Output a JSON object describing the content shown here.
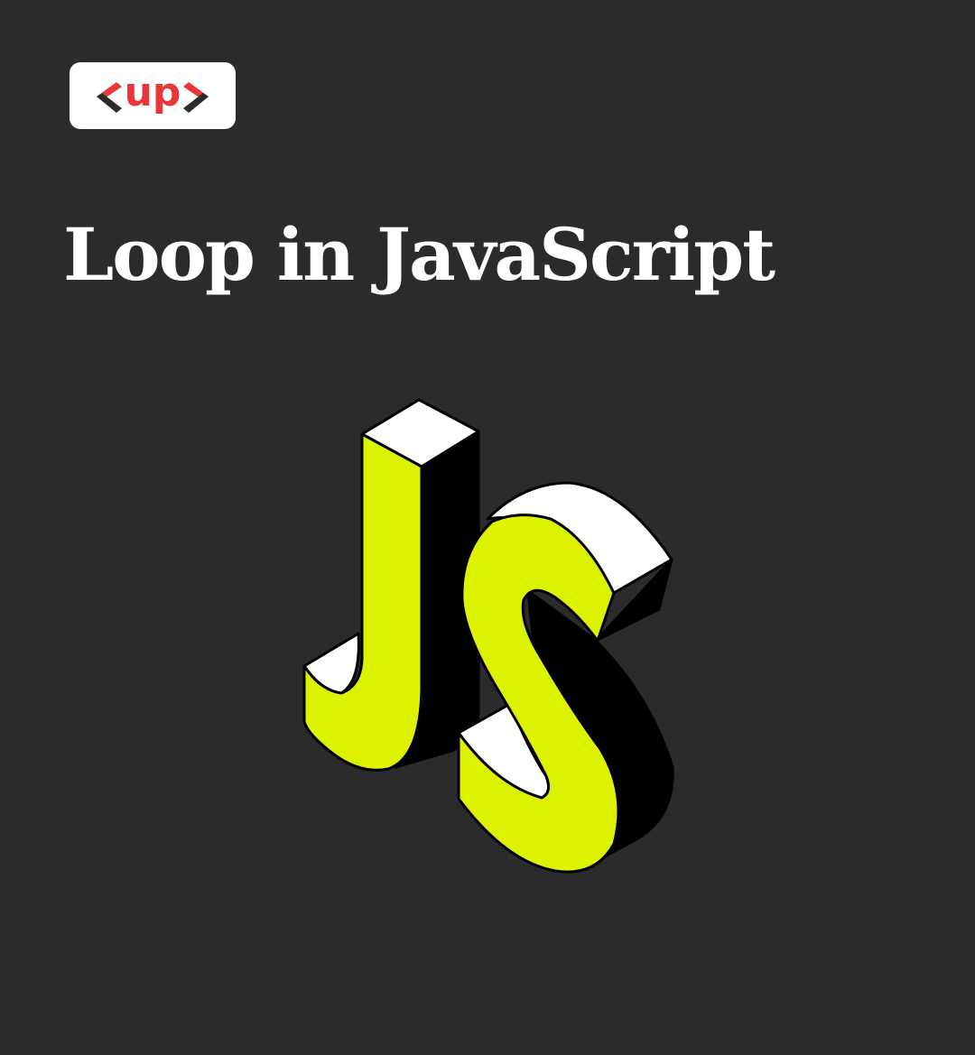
{
  "brand": {
    "logo_text": "up"
  },
  "title": "Loop in JavaScript",
  "artwork": {
    "letters": "JS",
    "colors": {
      "background": "#2b2b2b",
      "face": "#ddf200",
      "top": "#ffffff",
      "side": "#000000",
      "logo_accent": "#e8363b"
    }
  }
}
